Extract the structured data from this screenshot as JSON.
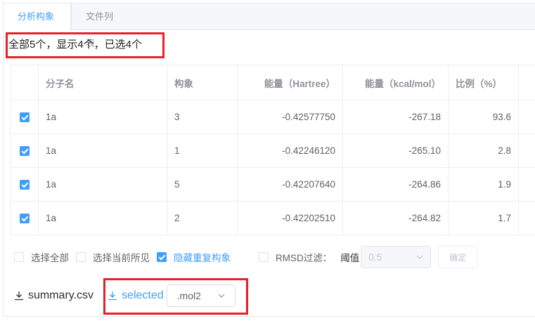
{
  "tabs": [
    {
      "label": "分析构象",
      "active": true
    },
    {
      "label": "文件列表",
      "active": false
    }
  ],
  "summary": "全部5个，显示4个，已选4个",
  "table": {
    "headers": [
      "分子名",
      "构象",
      "能量（Hartree）",
      "能量（kcal/mol）",
      "比例（%）"
    ],
    "rows": [
      {
        "checked": true,
        "name": "1a",
        "conf": "3",
        "hartree": "-0.42577750",
        "kcal": "-267.18",
        "ratio": "93.6"
      },
      {
        "checked": true,
        "name": "1a",
        "conf": "1",
        "hartree": "-0.42246120",
        "kcal": "-265.10",
        "ratio": "2.8"
      },
      {
        "checked": true,
        "name": "1a",
        "conf": "5",
        "hartree": "-0.42207640",
        "kcal": "-264.86",
        "ratio": "1.9"
      },
      {
        "checked": true,
        "name": "1a",
        "conf": "2",
        "hartree": "-0.42202510",
        "kcal": "-264.82",
        "ratio": "1.7"
      }
    ]
  },
  "options": {
    "select_all": "选择全部",
    "select_visible": "选择当前所见",
    "hide_duplicates": "隐藏重复构象",
    "rmsd_filter": "RMSD过滤：",
    "threshold_label": "阈值",
    "threshold_value": "0.5",
    "confirm": "确定"
  },
  "downloads": {
    "summary": "summary.csv",
    "selected": "selected",
    "format": ".mol2"
  },
  "colors": {
    "accent": "#409eff",
    "highlight": "#e8202a"
  }
}
